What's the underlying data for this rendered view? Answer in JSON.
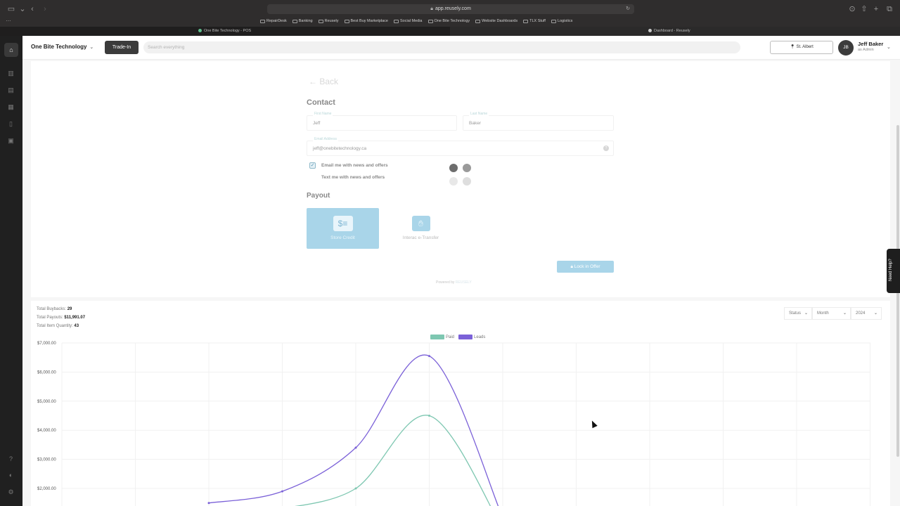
{
  "browser": {
    "url": "app.reusely.com",
    "bookmarks": [
      "RepairDesk",
      "Banking",
      "Reusely",
      "Best Buy Marketplace",
      "Social Media",
      "One Bite Technology",
      "Website Dashboards",
      "TLX Stuff",
      "Logistics"
    ],
    "tabs": [
      {
        "title": "One Bite Technology - POS",
        "active": false
      },
      {
        "title": "Dashboard - Reusely",
        "active": true
      }
    ]
  },
  "header": {
    "brand": "One Bite Technology",
    "trade_in_label": "Trade-In",
    "search_placeholder": "Search everything",
    "location": "St. Albert",
    "avatar_initials": "JB",
    "user_name": "Jeff Baker",
    "user_role": "as Admin"
  },
  "form": {
    "back_label": "Back",
    "contact_heading": "Contact",
    "first_name_label": "First Name",
    "first_name_value": "Jeff",
    "last_name_label": "Last Name",
    "last_name_value": "Baker",
    "email_label": "Email Address",
    "email_value": "jeff@onebitetechnology.ca",
    "email_opt_label": "Email me with news and offers",
    "email_opt_checked": true,
    "text_opt_label": "Text me with news and offers",
    "text_opt_checked": false,
    "payout_heading": "Payout",
    "payout_options": [
      {
        "label": "Store Credit",
        "selected": true,
        "icon": "store-credit-icon"
      },
      {
        "label": "Interac e-Transfer",
        "selected": false,
        "icon": "interac-icon"
      }
    ],
    "lock_button_label": "Lock in Offer",
    "powered_by": "Powered by",
    "powered_by_brand": "REUSELY"
  },
  "dashboard": {
    "total_buybacks_label": "Total Buybacks:",
    "total_buybacks": "29",
    "total_payouts_label": "Total Payouts:",
    "total_payouts": "$11,991.07",
    "total_quantity_label": "Total Item Quantity:",
    "total_quantity": "43",
    "filters": {
      "status": "Status",
      "period": "Month",
      "year": "2024"
    }
  },
  "help_tab_label": "Need Help?",
  "colors": {
    "paid": "#7ec7b1",
    "leads": "#7b61d8",
    "accent": "#a9d5e9"
  },
  "chart_data": {
    "type": "line",
    "y_tick_labels": [
      "$7,000.00",
      "$6,000.00",
      "$5,000.00",
      "$4,000.00",
      "$3,000.00",
      "$2,000.00"
    ],
    "ylim": [
      2000,
      7000
    ],
    "grid": true,
    "legend": "top-center",
    "series": [
      {
        "name": "Paid",
        "color": "#7ec7b1",
        "points": [
          [
            3,
            1300
          ],
          [
            4,
            2000
          ],
          [
            5,
            4500
          ],
          [
            6,
            600
          ]
        ]
      },
      {
        "name": "Leads",
        "color": "#7b61d8",
        "points": [
          [
            2,
            1500
          ],
          [
            3,
            1900
          ],
          [
            4,
            3400
          ],
          [
            5,
            6550
          ],
          [
            6,
            1000
          ]
        ]
      }
    ]
  }
}
